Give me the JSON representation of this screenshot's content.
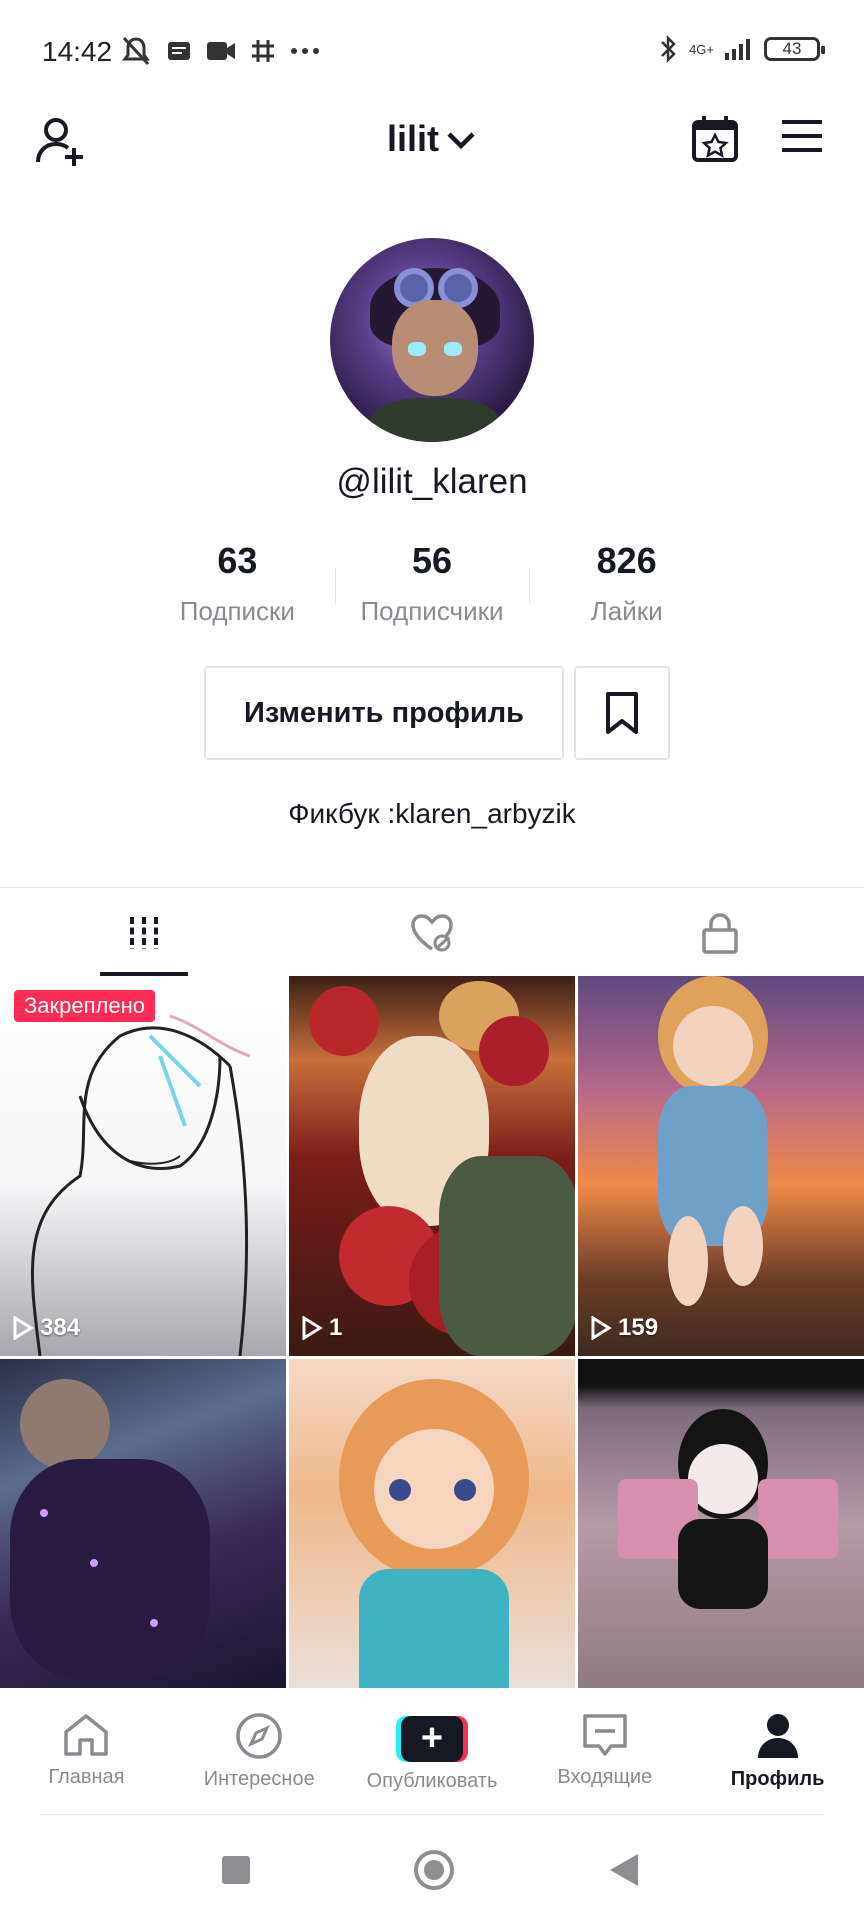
{
  "status_bar": {
    "time": "14:42",
    "network": "4G+",
    "battery": "43"
  },
  "header": {
    "title": "lilit"
  },
  "profile": {
    "handle": "@lilit_klaren",
    "stats": [
      {
        "value": "63",
        "label": "Подписки"
      },
      {
        "value": "56",
        "label": "Подписчики"
      },
      {
        "value": "826",
        "label": "Лайки"
      }
    ],
    "edit_label": "Изменить профиль",
    "bio": "Фикбук :klaren_arbyzik"
  },
  "tabs": [
    {
      "icon": "grid-icon",
      "active": true
    },
    {
      "icon": "liked-hidden-icon",
      "active": false
    },
    {
      "icon": "lock-icon",
      "active": false
    }
  ],
  "videos": [
    {
      "views": "384",
      "pinned_label": "Закреплено"
    },
    {
      "views": "1"
    },
    {
      "views": "159"
    },
    {
      "views": ""
    },
    {
      "views": ""
    },
    {
      "views": ""
    }
  ],
  "bottom_nav": [
    {
      "label": "Главная",
      "icon": "home-icon"
    },
    {
      "label": "Интересное",
      "icon": "compass-icon"
    },
    {
      "label": "Опубликовать",
      "icon": "publish-icon"
    },
    {
      "label": "Входящие",
      "icon": "inbox-icon"
    },
    {
      "label": "Профиль",
      "icon": "profile-icon",
      "active": true
    }
  ],
  "colors": {
    "accent": "#fe2c55",
    "cyan": "#25f4ee",
    "text": "#161823",
    "muted": "#8a8b91"
  }
}
